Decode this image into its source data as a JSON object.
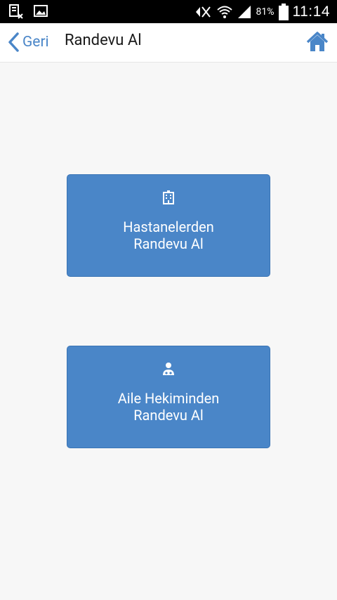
{
  "status_bar": {
    "battery": "81%",
    "time": "11:14"
  },
  "header": {
    "back_label": "Geri",
    "title": "Randevu Al"
  },
  "actions": [
    {
      "icon": "hospital-icon",
      "line1": "Hastanelerden",
      "line2": "Randevu Al"
    },
    {
      "icon": "doctor-icon",
      "line1": "Aile Hekiminden",
      "line2": "Randevu Al"
    }
  ],
  "colors": {
    "accent": "#4a86c8",
    "background": "#f7f7f7",
    "header_bg": "#ffffff",
    "status_bar": "#000000"
  }
}
